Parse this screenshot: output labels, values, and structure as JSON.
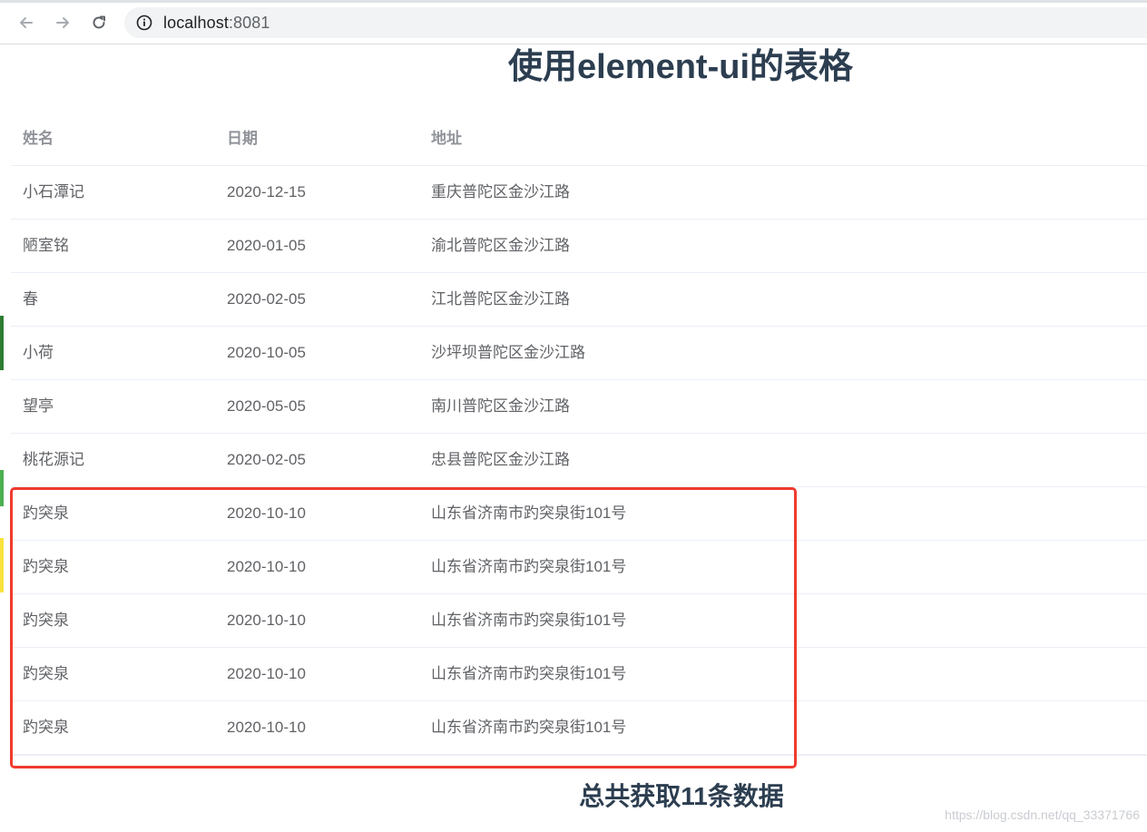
{
  "browser": {
    "url_host": "localhost",
    "url_port": ":8081",
    "back_icon": "back-arrow-icon",
    "forward_icon": "forward-arrow-icon",
    "reload_icon": "reload-icon",
    "info_icon": "info-icon"
  },
  "page": {
    "title": "使用element-ui的表格",
    "summary": "总共获取11条数据",
    "watermark": "https://blog.csdn.net/qq_33371766"
  },
  "table": {
    "headers": {
      "name": "姓名",
      "date": "日期",
      "address": "地址"
    },
    "rows": [
      {
        "name": "小石潭记",
        "date": "2020-12-15",
        "address": "重庆普陀区金沙江路"
      },
      {
        "name": "陋室铭",
        "date": "2020-01-05",
        "address": "渝北普陀区金沙江路"
      },
      {
        "name": "春",
        "date": "2020-02-05",
        "address": "江北普陀区金沙江路"
      },
      {
        "name": "小荷",
        "date": "2020-10-05",
        "address": "沙坪坝普陀区金沙江路"
      },
      {
        "name": "望亭",
        "date": "2020-05-05",
        "address": "南川普陀区金沙江路"
      },
      {
        "name": "桃花源记",
        "date": "2020-02-05",
        "address": "忠县普陀区金沙江路"
      },
      {
        "name": "趵突泉",
        "date": "2020-10-10",
        "address": "山东省济南市趵突泉街101号"
      },
      {
        "name": "趵突泉",
        "date": "2020-10-10",
        "address": "山东省济南市趵突泉街101号"
      },
      {
        "name": "趵突泉",
        "date": "2020-10-10",
        "address": "山东省济南市趵突泉街101号"
      },
      {
        "name": "趵突泉",
        "date": "2020-10-10",
        "address": "山东省济南市趵突泉街101号"
      },
      {
        "name": "趵突泉",
        "date": "2020-10-10",
        "address": "山东省济南市趵突泉街101号"
      }
    ]
  },
  "colors": {
    "title": "#2c3e50",
    "header_text": "#909399",
    "cell_text": "#606266",
    "row_border": "#ebeef5",
    "highlight_box": "#f03a2e"
  }
}
